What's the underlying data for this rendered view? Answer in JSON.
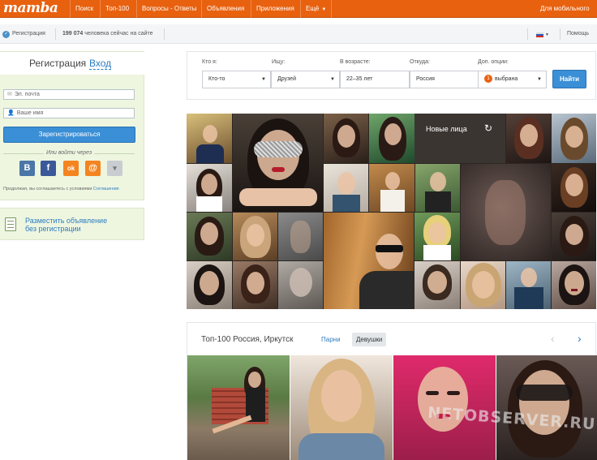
{
  "header": {
    "logo": "mamba",
    "nav": [
      "Поиск",
      "Топ-100",
      "Вопросы - Ответы",
      "Объявления",
      "Приложения",
      "Ещё"
    ],
    "mobile_link": "Для мобильного"
  },
  "subbar": {
    "registration": "Регистрация",
    "online_count": "199 074",
    "online_text": "человека сейчас на сайте",
    "help": "Помощь",
    "lang_icon": "russian-flag-icon"
  },
  "register": {
    "tab_register": "Регистрация",
    "tab_login": "Вход",
    "email_placeholder": "Эл. почта",
    "name_placeholder": "Ваше имя",
    "submit_label": "Зарегистрироваться",
    "or_via": "Или войти через",
    "social": [
      {
        "name": "vk-icon",
        "glyph": "В",
        "color": "#4a76a8"
      },
      {
        "name": "facebook-icon",
        "glyph": "f",
        "color": "#3b5998"
      },
      {
        "name": "odnoklassniki-icon",
        "glyph": "ok",
        "color": "#f48420"
      },
      {
        "name": "mailru-icon",
        "glyph": "@",
        "color": "#168de2"
      },
      {
        "name": "more-icon",
        "glyph": "▾",
        "color": "#c9ccd0"
      }
    ],
    "terms_prefix": "Продолжая, вы соглашаетесь с условиями",
    "terms_link": "Соглашения"
  },
  "ad": {
    "line1": "Разместить объявление",
    "line2": "без регистрации"
  },
  "search": {
    "labels": [
      "Кто я:",
      "Ищу:",
      "В возрасте:",
      "Откуда:",
      "Доп. опции:"
    ],
    "who": "Кто-то",
    "seek": "Друзей",
    "age": "22–35 лет",
    "place": "Россия",
    "options_count": "1",
    "options": "выбрана",
    "find_label": "Найти"
  },
  "grid": {
    "new_faces_label": "Новые лица"
  },
  "top100": {
    "title": "Топ-100 Россия, Иркутск",
    "boys": "Парни",
    "girls": "Девушки"
  },
  "watermark": "NETOBSERVER.RU",
  "colors": {
    "brand": "#e8610f",
    "link": "#2d7cc0",
    "button": "#3a8fd6",
    "panel_green": "#eef6e0"
  }
}
